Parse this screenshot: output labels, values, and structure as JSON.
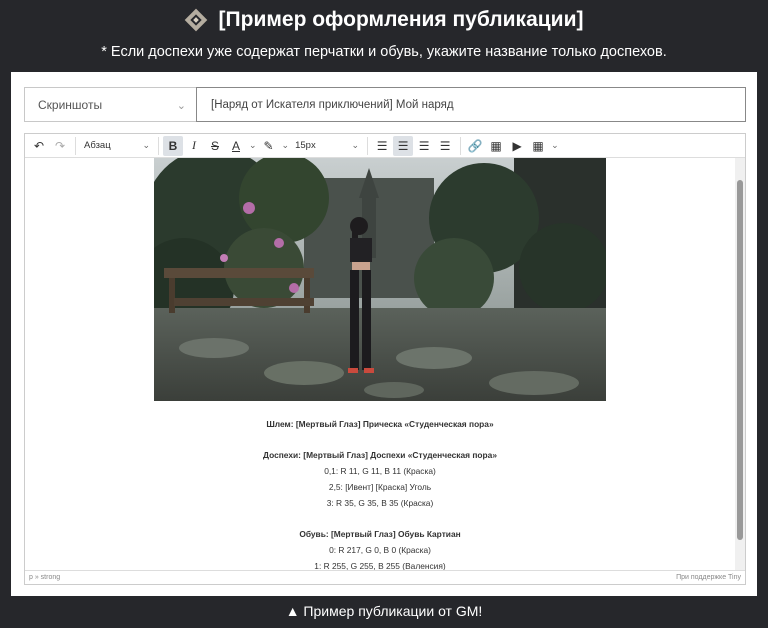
{
  "header": {
    "title": "[Пример оформления публикации]",
    "note": "* Если доспехи уже содержат перчатки и обувь, укажите название только доспехов."
  },
  "form": {
    "category_value": "Скриншоты",
    "title_value": "[Наряд от Искателя приключений] Мой наряд"
  },
  "toolbar": {
    "format_value": "Абзац",
    "fontsize_value": "15px",
    "icons": [
      "undo-icon",
      "redo-icon",
      "bold-icon",
      "italic-icon",
      "strikethrough-icon",
      "text-color-icon",
      "highlight-icon",
      "align-left-icon",
      "align-center-icon",
      "align-right-icon",
      "align-justify-icon",
      "link-icon",
      "image-icon",
      "media-icon",
      "table-icon"
    ]
  },
  "content": {
    "lines": [
      {
        "text": "Шлем: [Мертвый Глаз] Прическа «Студенческая пора»",
        "bold": true
      },
      {
        "text": "",
        "bold": false
      },
      {
        "text": "Доспехи: [Мертвый Глаз] Доспехи «Студенческая пора»",
        "bold": true
      },
      {
        "text": "0,1: R 11, G 11, B 11 (Краска)",
        "bold": false
      },
      {
        "text": "2,5: [Ивент] [Краска] Уголь",
        "bold": false
      },
      {
        "text": "3: R 35, G 35, B 35 (Краска)",
        "bold": false
      },
      {
        "text": "",
        "bold": false
      },
      {
        "text": "Обувь: [Мертвый Глаз] Обувь Картиан",
        "bold": true
      },
      {
        "text": "0: R 217, G 0, B 0 (Краска)",
        "bold": false
      },
      {
        "text": "1: R 255, G 255, B 255 (Валенсия)",
        "bold": false
      }
    ]
  },
  "statusbar": {
    "path": "p » strong",
    "brand": "При поддержке Tiny"
  },
  "caption": "▲ Пример публикации от GM!"
}
